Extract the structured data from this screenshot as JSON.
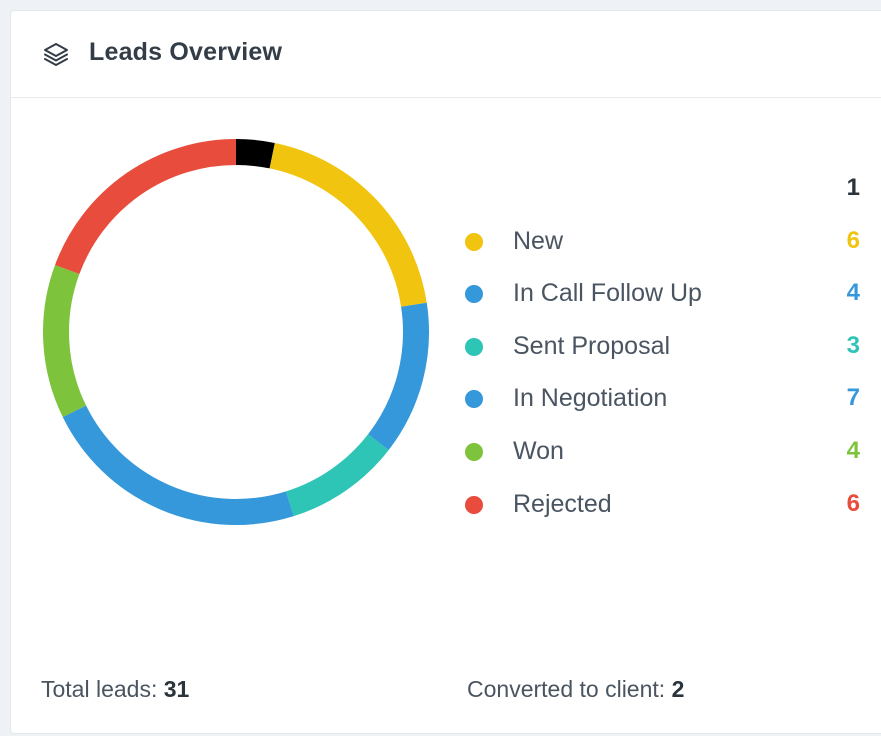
{
  "header": {
    "title": "Leads Overview",
    "icon": "layers-icon"
  },
  "chart_data": {
    "type": "pie",
    "variant": "donut",
    "title": "Leads Overview",
    "series": [
      {
        "name": "",
        "value": 1,
        "color": "#000000"
      },
      {
        "name": "New",
        "value": 6,
        "color": "#f1c40f"
      },
      {
        "name": "In Call Follow Up",
        "value": 4,
        "color": "#3498db"
      },
      {
        "name": "Sent Proposal",
        "value": 3,
        "color": "#2ec4b6"
      },
      {
        "name": "In Negotiation",
        "value": 7,
        "color": "#3498db"
      },
      {
        "name": "Won",
        "value": 4,
        "color": "#7dc43c"
      },
      {
        "name": "Rejected",
        "value": 6,
        "color": "#e74c3c"
      }
    ],
    "value_colors": [
      "#2b333b",
      "#f1c40f",
      "#3498db",
      "#2ec4b6",
      "#3498db",
      "#7dc43c",
      "#e74c3c"
    ],
    "legend_position": "right"
  },
  "footer": {
    "total_label": "Total leads:",
    "total_value": "31",
    "converted_label": "Converted to client:",
    "converted_value": "2"
  }
}
